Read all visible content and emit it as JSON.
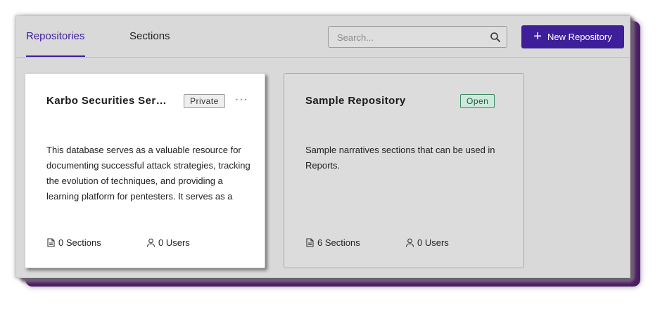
{
  "tabs": {
    "repositories": "Repositories",
    "sections": "Sections"
  },
  "search": {
    "placeholder": "Search...",
    "value": ""
  },
  "new_button": {
    "label": "New Repository"
  },
  "colors": {
    "accent": "#3f1e9a",
    "open_badge": "#cfe8dc",
    "private_badge": "#eeeeee"
  },
  "cards": [
    {
      "title": "Karbo Securities Services Database",
      "badge": "Private",
      "description": "This database serves as a valuable resource for documenting successful attack strategies, tracking the evolution of techniques, and providing a learning platform for pentesters. It serves as a reference for future engagements.",
      "sections": "0 Sections",
      "users": "0 Users"
    },
    {
      "title": "Sample Repository",
      "badge": "Open",
      "description": "Sample narratives sections that can be used in Reports.",
      "sections": "6 Sections",
      "users": "0 Users"
    }
  ]
}
